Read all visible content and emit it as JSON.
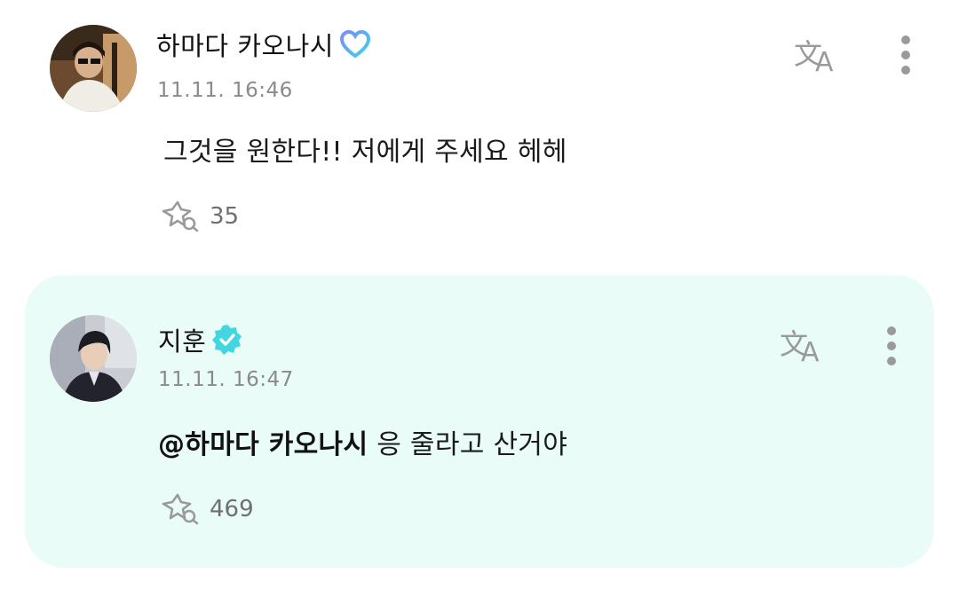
{
  "comments": [
    {
      "username": "하마다 카오나시",
      "badge_icon": "heart-badge-icon",
      "timestamp": "11.11. 16:46",
      "text": "그것을 원한다!! 저에게 주세요 헤헤",
      "likes": "35",
      "translate_icon": "translate-icon",
      "more_icon": "more-vertical-icon"
    },
    {
      "username": "지훈",
      "badge_icon": "verified-badge-icon",
      "timestamp": "11.11. 16:47",
      "mention": "@하마다 카오나시",
      "text": " 응 줄라고 산거야",
      "likes": "469",
      "translate_icon": "translate-icon",
      "more_icon": "more-vertical-icon",
      "highlight_color": "#e9fcf8"
    }
  ],
  "colors": {
    "verified": "#41d6e0",
    "heart_badge_start": "#7b8cff",
    "heart_badge_end": "#39d5e8",
    "icon_gray": "#9a9a9a"
  }
}
